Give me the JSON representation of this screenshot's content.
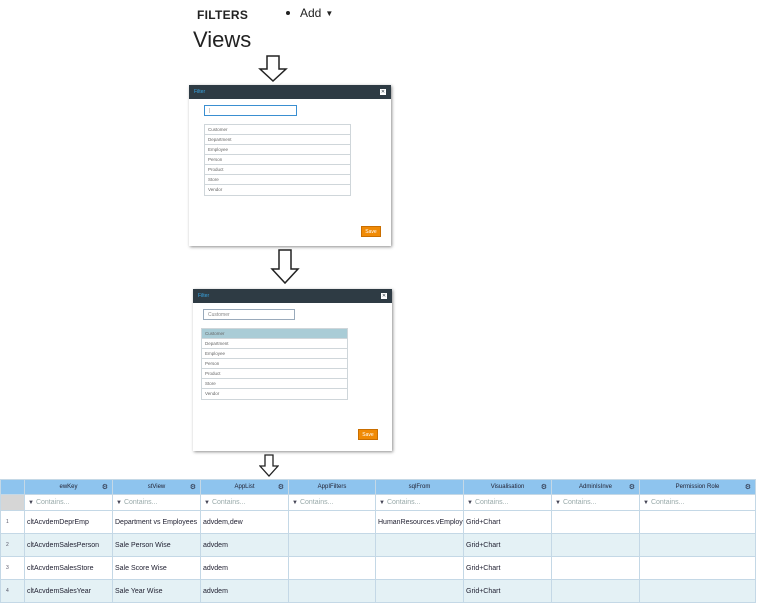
{
  "header": {
    "title": "FILTERS",
    "add_label": "Add"
  },
  "page_title": "Views",
  "dialog1": {
    "title": "Filter",
    "search_value": "|",
    "items": [
      "Customer",
      "Department",
      "Employee",
      "Person",
      "Product",
      "Store",
      "Vendor"
    ],
    "save_label": "Save"
  },
  "dialog2": {
    "title": "Filter",
    "search_value": "Customer",
    "items": [
      "Customer",
      "Department",
      "Employee",
      "Person",
      "Product",
      "Store",
      "Vendor"
    ],
    "selected_index": 0,
    "save_label": "Save"
  },
  "grid": {
    "columns": [
      "ewKey",
      "stView",
      "AppList",
      "AppIFilters",
      "sqlFrom",
      "Visualisation",
      "AdminIsInve",
      "Permission Role"
    ],
    "filter_placeholder": "Contains...",
    "rows": [
      {
        "num": "1",
        "cells": [
          "cltAcvdemDeprEmp",
          "Department vs Employees",
          "advdem,dew",
          "",
          "HumanResources.vEmployee",
          "Grid+Chart",
          "",
          ""
        ]
      },
      {
        "num": "2",
        "cells": [
          "cltAcvdemSalesPerson",
          "Sale Person Wise",
          "advdem",
          "",
          "",
          "Grid+Chart",
          "",
          ""
        ]
      },
      {
        "num": "3",
        "cells": [
          "cltAcvdemSalesStore",
          "Sale Score Wise",
          "advdem",
          "",
          "",
          "Grid+Chart",
          "",
          ""
        ]
      },
      {
        "num": "4",
        "cells": [
          "cltAcvdemSalesYear",
          "Sale Year Wise",
          "advdem",
          "",
          "",
          "Grid+Chart",
          "",
          ""
        ]
      }
    ]
  },
  "icons": {
    "gear": "gear-icon",
    "funnel": "filter-icon",
    "close": "close-icon",
    "arrow": "down-arrow-icon"
  },
  "colors": {
    "header_bg": "#8ec4ee",
    "dialog_titlebar": "#2e3b44",
    "save_button": "#f08a05",
    "selected_row": "#a9ccd6",
    "alt_row": "#e4f1f5"
  }
}
